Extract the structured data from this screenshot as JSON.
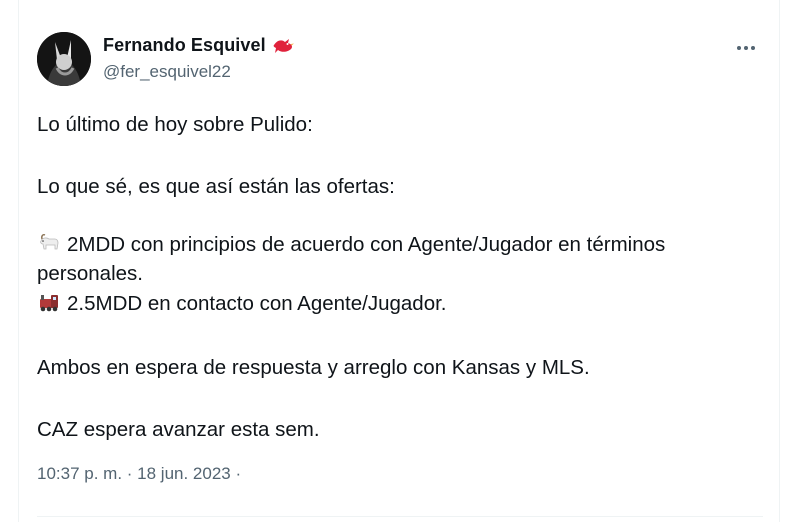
{
  "tweet": {
    "author_name": "Fernando Esquivel",
    "author_handle": "@fer_esquivel22",
    "lines": {
      "l1": "Lo último de hoy sobre Pulido:",
      "l2": "Lo que sé, es que así están las ofertas:",
      "l3a": "2MDD con principios de acuerdo con Agente/Jugador en términos",
      "l3b": "personales.",
      "l4": "2.5MDD en contacto con Agente/Jugador.",
      "l5": "Ambos en espera de respuesta y arreglo con Kansas y MLS.",
      "l6": "CAZ espera avanzar esta sem."
    },
    "timestamp": "10:37 p. m. · 18 jun. 2023 ·",
    "icons": {
      "badge": "red-bird-icon",
      "more": "more-options-icon",
      "emoji_1": "goat-emoji",
      "emoji_2": "train-emoji"
    },
    "colors": {
      "text": "#0f1419",
      "secondary": "#536471",
      "bird": "#e0223c"
    }
  }
}
